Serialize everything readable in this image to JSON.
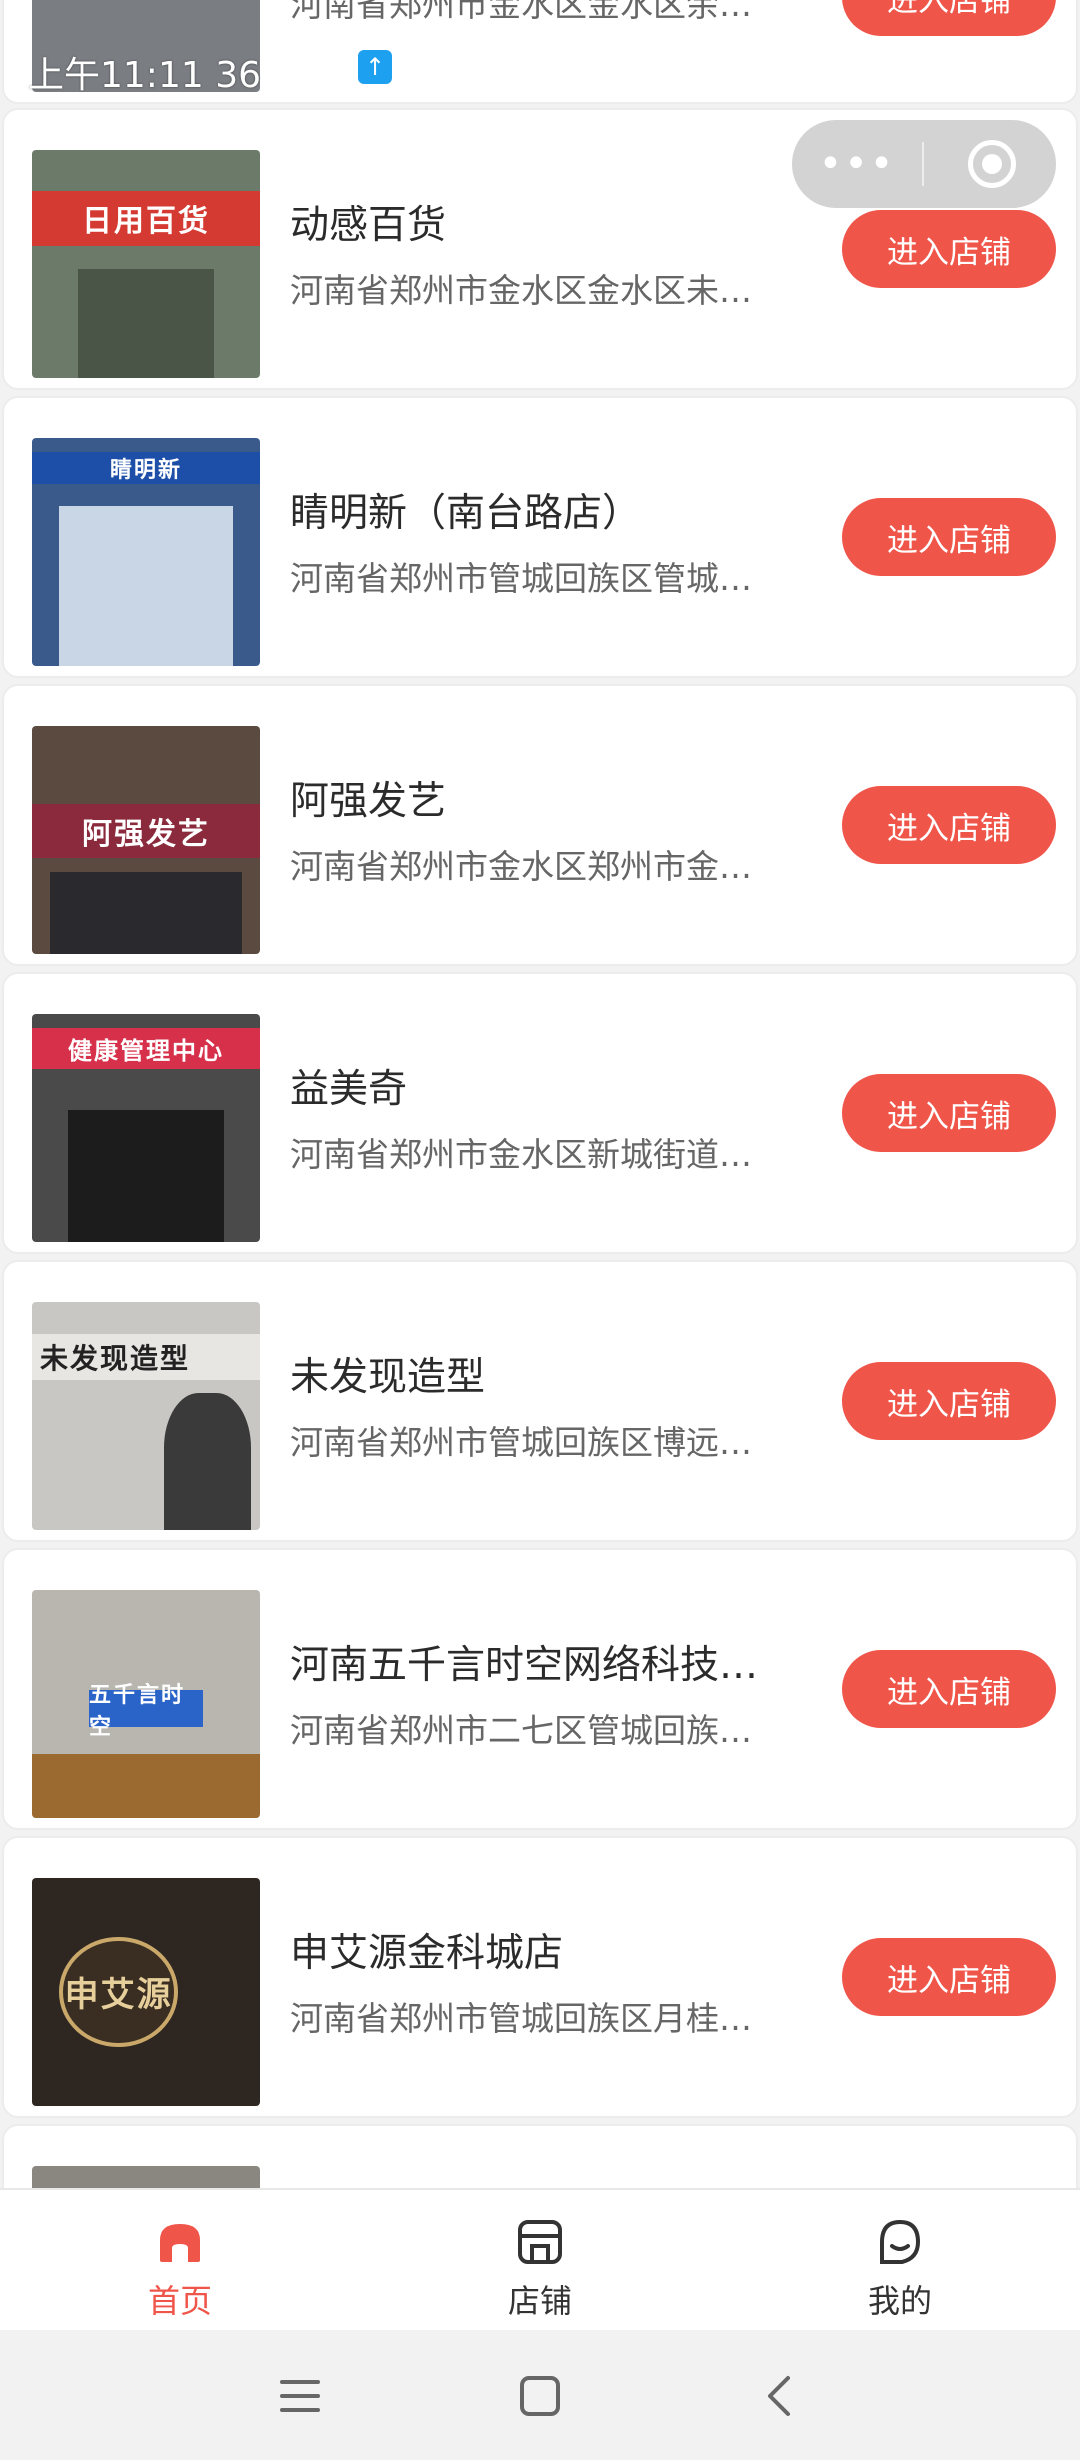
{
  "status_bar": {
    "time": "上午11:11 36"
  },
  "capsule": {
    "more_label": "•••"
  },
  "top_partial_card": {
    "addr": "河南省郑州市金水区金水区余…"
  },
  "enter_label": "进入店铺",
  "stores": [
    {
      "name": "动感百货",
      "addr": "河南省郑州市金水区金水区未…",
      "sign": "日用百货",
      "sign_bg": "#d43a32",
      "sign_fg": "#ffffff",
      "scene": "#6c7a6a"
    },
    {
      "name": "睛明新（南台路店）",
      "addr": "河南省郑州市管城回族区管城…",
      "sign": "睛明新",
      "sign_bg": "#1e4fa8",
      "sign_fg": "#ffffff",
      "scene": "#3a5a8c"
    },
    {
      "name": "阿强发艺",
      "addr": "河南省郑州市金水区郑州市金…",
      "sign": "阿强发艺",
      "sign_bg": "#8a2a3c",
      "sign_fg": "#ffffff",
      "scene": "#5a4a40"
    },
    {
      "name": "益美奇",
      "addr": "河南省郑州市金水区新城街道…",
      "sign": "健康管理中心",
      "sign_bg": "#d6304a",
      "sign_fg": "#ffffff",
      "scene": "#4a4a4a"
    },
    {
      "name": "未发现造型",
      "addr": "河南省郑州市管城回族区博远…",
      "sign": "未发现造型",
      "sign_bg": "#e8e6e2",
      "sign_fg": "#222222",
      "scene": "#c9c7c3"
    },
    {
      "name": "河南五千言时空网络科技…",
      "addr": "河南省郑州市二七区管城回族…",
      "sign": "五千言时空",
      "sign_bg": "#2a64c8",
      "sign_fg": "#ffffff",
      "scene": "#b9b6b0"
    },
    {
      "name": "申艾源金科城店",
      "addr": "河南省郑州市管城回族区月桂…",
      "sign": "申艾源",
      "sign_bg": "#3a2e22",
      "sign_fg": "#e6cf9a",
      "scene": "#2e2620"
    }
  ],
  "tabbar": {
    "home": "首页",
    "store": "店铺",
    "mine": "我的",
    "active_color": "#f0554a"
  }
}
